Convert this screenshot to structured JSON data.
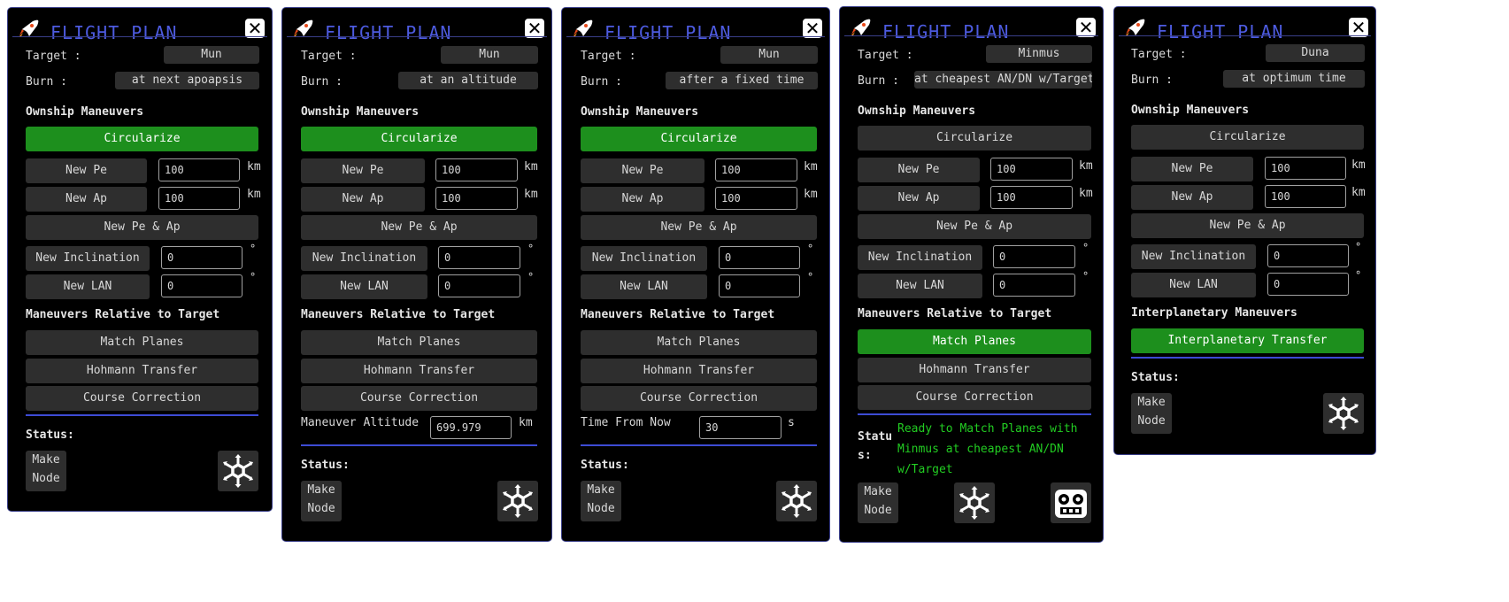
{
  "title": "FLIGHT PLAN",
  "labels": {
    "target": "Target :",
    "burn": "Burn :",
    "ownship": "Ownship Maneuvers",
    "relative": "Maneuvers Relative to Target",
    "interplanetary": "Interplanetary Maneuvers",
    "status": "Status:",
    "km": "km",
    "deg": "°",
    "s": "s",
    "maneuver_altitude": "Maneuver Altitude",
    "time_from_now": "Time From Now"
  },
  "buttons": {
    "circularize": "Circularize",
    "new_pe": "New Pe",
    "new_ap": "New Ap",
    "new_pe_ap": "New Pe & Ap",
    "new_inclination": "New Inclination",
    "new_lan": "New LAN",
    "match_planes": "Match Planes",
    "hohmann": "Hohmann Transfer",
    "course_correction": "Course Correction",
    "interplanetary_transfer": "Interplanetary Transfer",
    "make_node_1": "Make",
    "make_node_2": "Node"
  },
  "fields": {
    "new_pe": "100",
    "new_ap": "100",
    "new_inclination": "0",
    "new_lan": "0"
  },
  "panels": [
    {
      "target": "Mun",
      "burn": "at next apoapsis",
      "green": "circularize"
    },
    {
      "target": "Mun",
      "burn": "at an altitude",
      "green": "circularize",
      "extra_value": "699.979"
    },
    {
      "target": "Mun",
      "burn": "after a fixed time",
      "green": "circularize",
      "extra_value": "30"
    },
    {
      "target": "Minmus",
      "burn": "at cheapest AN/DN w/Target",
      "green": "match_planes",
      "status_lines": [
        "Ready to Match Planes with",
        "Minmus at cheapest AN/DN",
        "w/Target"
      ],
      "status_label_1": "Statu",
      "status_label_2": "s:"
    },
    {
      "target": "Duna",
      "burn": "at optimum time",
      "green": "interplanetary"
    }
  ],
  "colors": {
    "accent": "#4d5be0",
    "green_button": "#1d8f1d",
    "status_text": "#22cc22",
    "button": "#2e2e2e"
  }
}
